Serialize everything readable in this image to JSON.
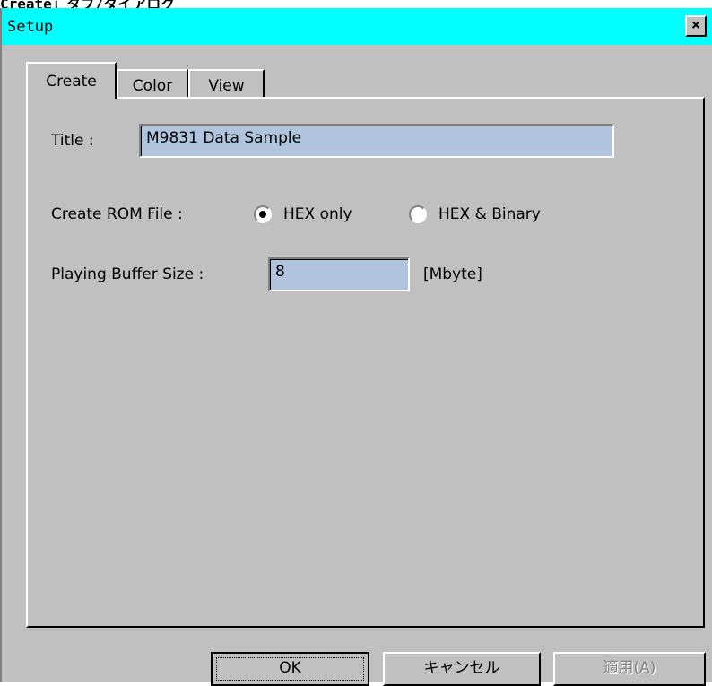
{
  "page_header": "Create」タブ/ダイアログ",
  "window": {
    "title": "Setup",
    "close_glyph": "×"
  },
  "tabs": [
    {
      "label": "Create"
    },
    {
      "label": "Color"
    },
    {
      "label": "View"
    }
  ],
  "create_tab": {
    "title_label": "Title :",
    "title_value": "M9831 Data Sample",
    "rom_label": "Create ROM File :",
    "rom_options": [
      {
        "label": "HEX only",
        "selected": true
      },
      {
        "label": "HEX & Binary",
        "selected": false
      }
    ],
    "buffer_label": "Playing Buffer Size :",
    "buffer_value": "8",
    "buffer_unit": "[Mbyte]"
  },
  "buttons": {
    "ok": "OK",
    "cancel": "キャンセル",
    "apply": "適用(A)"
  },
  "colors": {
    "title_bar": "#00ffff",
    "face": "#c0c0c0",
    "field_bg": "#b0c4de"
  }
}
